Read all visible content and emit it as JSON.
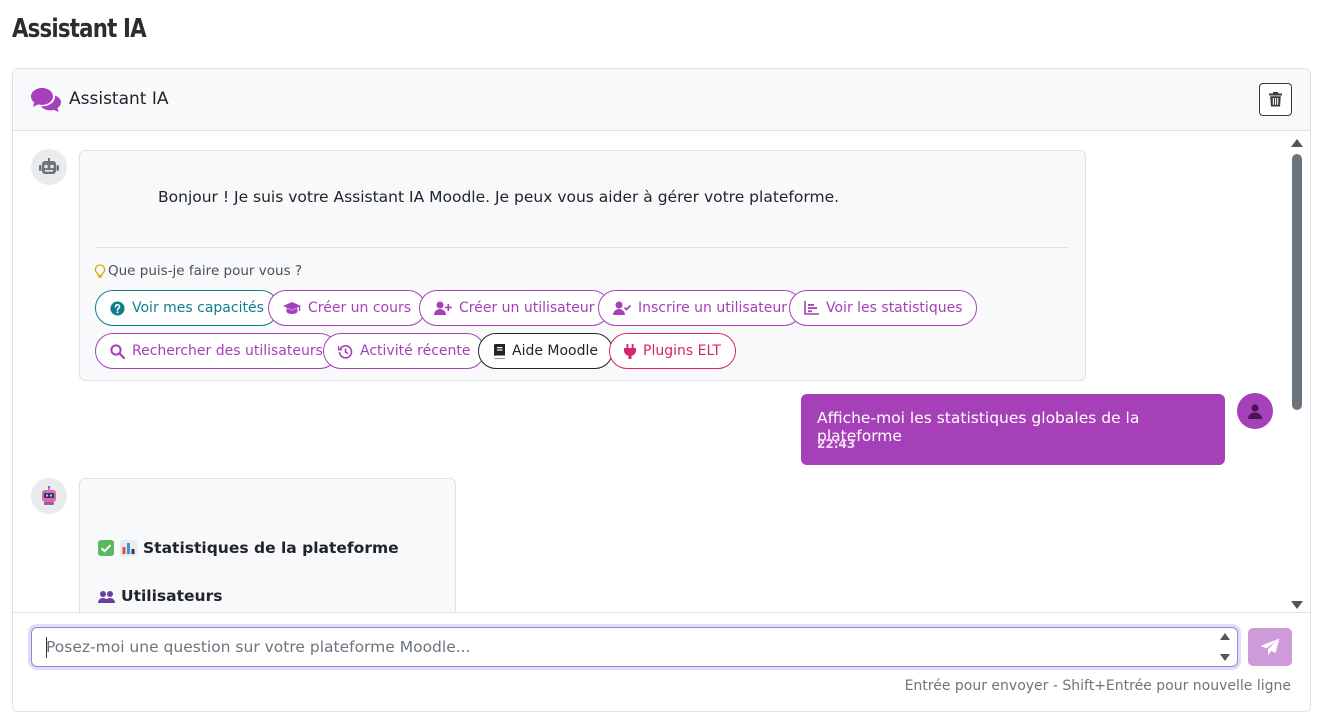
{
  "page": {
    "title": "Assistant IA"
  },
  "card": {
    "title": "Assistant IA"
  },
  "messages": {
    "welcome": "Bonjour ! Je suis votre Assistant IA Moodle. Je peux vous aider à gérer votre plateforme.",
    "suggest_label": "Que puis-je faire pour vous ?",
    "quick_actions": [
      {
        "label": "Voir mes capacités",
        "icon": "question-circle-icon"
      },
      {
        "label": "Créer un cours",
        "icon": "graduation-cap-icon"
      },
      {
        "label": "Créer un utilisateur",
        "icon": "user-plus-icon"
      },
      {
        "label": "Inscrire un utilisateur",
        "icon": "user-check-icon"
      },
      {
        "label": "Voir les statistiques",
        "icon": "chart-icon"
      },
      {
        "label": "Rechercher des utilisateurs",
        "icon": "search-icon"
      },
      {
        "label": "Activité récente",
        "icon": "history-icon"
      },
      {
        "label": "Aide Moodle",
        "icon": "book-icon"
      },
      {
        "label": "Plugins ELT",
        "icon": "plug-icon"
      }
    ],
    "user_message": "Affiche-moi les statistiques globales de la plateforme",
    "user_time": "22:43",
    "stats_title": "Statistiques de la plateforme",
    "users_title": "Utilisateurs"
  },
  "input": {
    "placeholder": "Posez-moi une question sur votre plateforme Moodle...",
    "value": "",
    "hint": "Entrée pour envoyer - Shift+Entrée pour nouvelle ligne"
  },
  "colors": {
    "accent": "#a640b8",
    "teal": "#0f7d8c",
    "pink": "#d6246e",
    "send_button": "#cf9ad8"
  }
}
